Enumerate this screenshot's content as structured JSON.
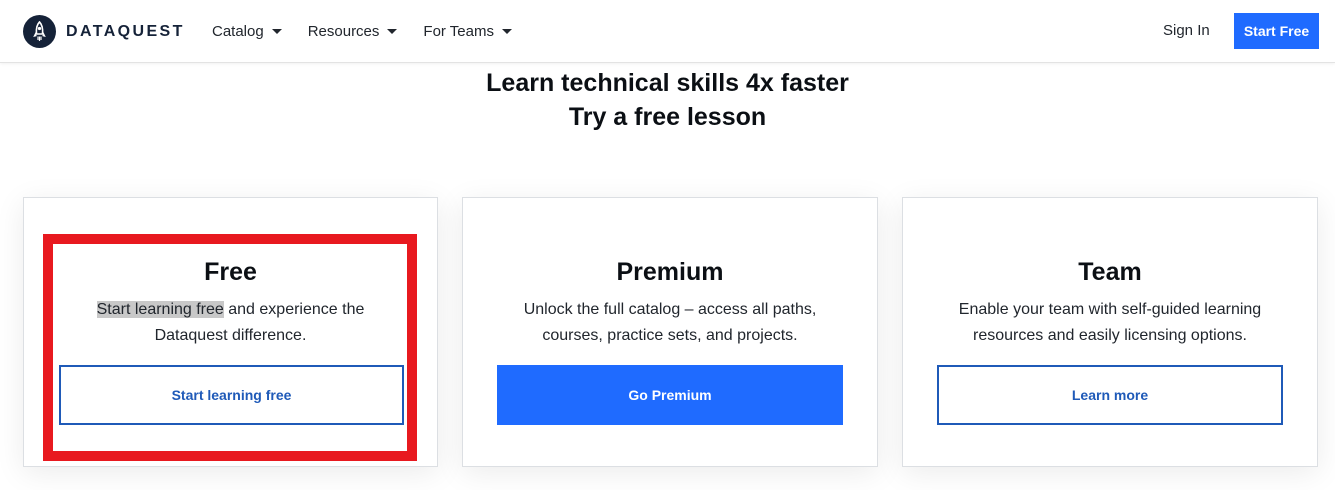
{
  "header": {
    "logo_text": "DATAQUEST",
    "nav": [
      {
        "label": "Catalog"
      },
      {
        "label": "Resources"
      },
      {
        "label": "For Teams"
      }
    ],
    "sign_in": "Sign In",
    "start_free": "Start Free"
  },
  "hero": {
    "line1": "Learn technical skills 4x faster",
    "line2": "Try a free lesson"
  },
  "cards": [
    {
      "title": "Free",
      "desc_highlight": "Start learning free",
      "desc_rest_line1": " and experience the",
      "desc_line2": "Dataquest difference.",
      "button": "Start learning free"
    },
    {
      "title": "Premium",
      "desc_line1": "Unlock the full catalog – access all paths,",
      "desc_line2": "courses, practice sets, and projects.",
      "button": "Go Premium"
    },
    {
      "title": "Team",
      "desc_line1": "Enable your team with self-guided learning",
      "desc_line2": "resources and easily licensing options.",
      "button": "Learn more"
    }
  ],
  "colors": {
    "brand_blue": "#1f6bff",
    "outline_blue": "#1f5ab8",
    "highlight_red": "#e8191f",
    "logo_navy": "#152238"
  }
}
